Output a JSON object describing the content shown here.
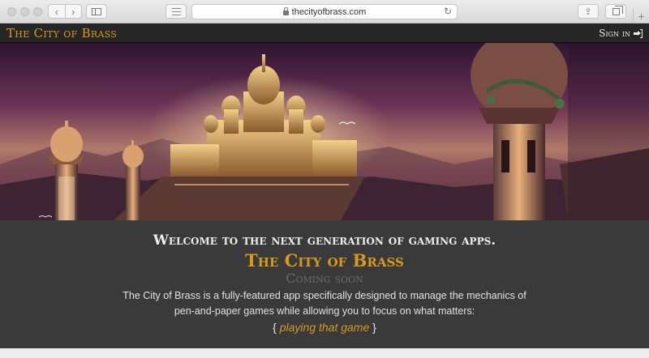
{
  "browser": {
    "url": "thecityofbrass.com",
    "icons": {
      "back": "chevron-left-icon",
      "forward": "chevron-right-icon",
      "sidebar": "sidebar-icon",
      "reader": "reader-icon",
      "lock": "lock-icon",
      "reload": "reload-icon",
      "share": "share-icon",
      "tabs": "tabs-icon",
      "new_tab": "plus-icon"
    }
  },
  "nav": {
    "brand": "The City of Brass",
    "signin_label": "Sign in",
    "signin_icon": "sign-in-icon"
  },
  "hero": {
    "image": "fantasy-city-illustration"
  },
  "content": {
    "welcome": "Welcome to the next generation of gaming apps.",
    "title": "The City of Brass",
    "coming_soon": "Coming soon",
    "description": "The City of Brass is a fully-featured app specifically designed to manage the mechanics of pen-and-paper games while allowing you to focus on what matters:",
    "tagline_open": "{ ",
    "tagline_highlight": "playing that game",
    "tagline_close": " }"
  },
  "colors": {
    "accent": "#d89a1c",
    "nav_bg": "#262626",
    "content_bg": "#3a3a3a",
    "text": "#e2e2e2",
    "muted": "#6a6a6a"
  }
}
